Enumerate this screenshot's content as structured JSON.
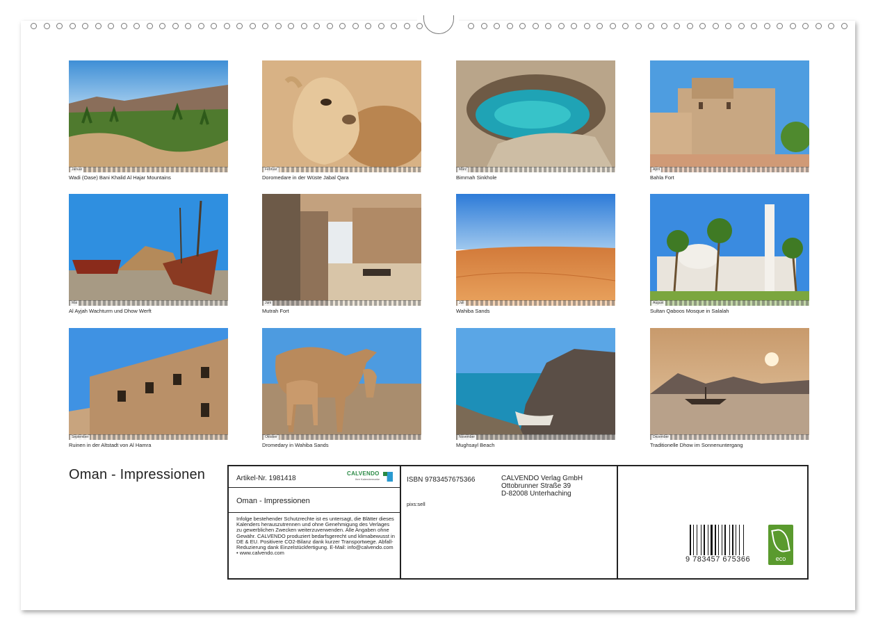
{
  "thumbnails": [
    {
      "caption": "Wadi (Oase) Bani Khalid Al Hajar Mountains",
      "month": "Januar"
    },
    {
      "caption": "Doromedare in der Wüste Jabal Qara",
      "month": "Februar"
    },
    {
      "caption": "Bimmah Sinkhole",
      "month": "März"
    },
    {
      "caption": "Bahla Fort",
      "month": "April"
    },
    {
      "caption": "Al Ayjah Wachturm und Dhow Werft",
      "month": "Mai"
    },
    {
      "caption": "Mutrah Fort",
      "month": "Juni"
    },
    {
      "caption": "Wahiba Sands",
      "month": "Juli"
    },
    {
      "caption": "Sultan Qaboos Mosque in Salalah",
      "month": "August"
    },
    {
      "caption": "Ruinen in der Altstadt von Al Hamra",
      "month": "September"
    },
    {
      "caption": "Dromedary in Wahiba Sands",
      "month": "Oktober"
    },
    {
      "caption": "Mughsayl Beach",
      "month": "November"
    },
    {
      "caption": "Traditionelle Dhow im Sonnenuntergang",
      "month": "Dezember"
    }
  ],
  "title": "Oman - Impressionen",
  "info": {
    "article": "Artikel-Nr. 1981418",
    "logo": "CALVENDO",
    "logo_sub": "Ihre Kalendermarke",
    "subtitle": "Oman - Impressionen",
    "legal": "Infolge bestehender Schutzrechte ist es untersagt, die Blätter dieses Kalenders herauszutrennen und ohne Genehmigung des Verlages zu gewerblichen Zwecken weiterzuverwenden. Alle Angaben ohne Gewähr. CALVENDO produziert bedarfsgerecht und klimabewusst in DE & EU. Positivere CO2-Bilanz dank kurzer Transportwege. Abfall-Reduzierung dank Einzelstückfertigung. E-Mail: info@calvendo.com • www.calvendo.com",
    "isbn": "ISBN 9783457675366",
    "author": "pixs:sell",
    "publisher_name": "CALVENDO Verlag GmbH",
    "publisher_street": "Ottobrunner Straße 39",
    "publisher_city": "D-82008 Unterhaching",
    "barcode_digits": "9 783457 675366",
    "eco_label": "eco"
  }
}
